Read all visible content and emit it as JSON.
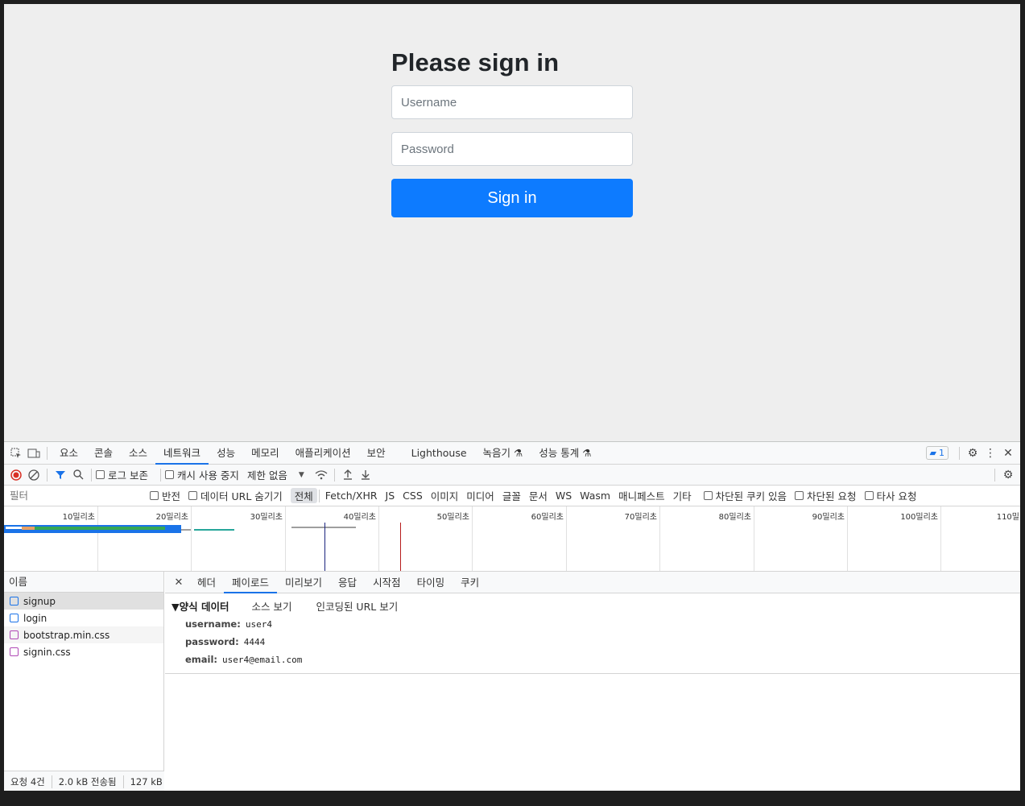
{
  "page": {
    "title": "Please sign in",
    "username_placeholder": "Username",
    "password_placeholder": "Password",
    "signin_label": "Sign in"
  },
  "devtools": {
    "main_tabs": [
      "요소",
      "콘솔",
      "소스",
      "네트워크",
      "성능",
      "메모리",
      "애플리케이션",
      "보안",
      "Lighthouse",
      "녹음기",
      "성능 통계"
    ],
    "active_tab": "네트워크",
    "issues_badge": "1",
    "toolbar": {
      "preserve_log": "로그 보존",
      "disable_cache": "캐시 사용 중지",
      "throttle": "제한 없음"
    },
    "filter": {
      "placeholder": "필터",
      "invert": "반전",
      "hide_data_urls": "데이터 URL 숨기기",
      "types": [
        "전체",
        "Fetch/XHR",
        "JS",
        "CSS",
        "이미지",
        "미디어",
        "글꼴",
        "문서",
        "WS",
        "Wasm",
        "매니페스트",
        "기타"
      ],
      "blocked_cookies": "차단된 쿠키 있음",
      "blocked_requests": "차단된 요청",
      "third_party": "타사 요청"
    },
    "timeline_ticks": [
      "10밀리초",
      "20밀리초",
      "30밀리초",
      "40밀리초",
      "50밀리초",
      "60밀리초",
      "70밀리초",
      "80밀리초",
      "90밀리초",
      "100밀리초",
      "110밀"
    ],
    "name_header": "이름",
    "requests": [
      {
        "name": "signup",
        "type": "doc"
      },
      {
        "name": "login",
        "type": "doc"
      },
      {
        "name": "bootstrap.min.css",
        "type": "css"
      },
      {
        "name": "signin.css",
        "type": "css"
      }
    ],
    "status": {
      "requests": "요청 4건",
      "transferred": "2.0 kB 전송됨",
      "resources": "127 kB"
    },
    "detail_tabs": [
      "헤더",
      "페이로드",
      "미리보기",
      "응답",
      "시작점",
      "타이밍",
      "쿠키"
    ],
    "active_detail_tab": "페이로드",
    "payload": {
      "section_title": "▼양식 데이터",
      "view_source": "소스 보기",
      "view_url_encoded": "인코딩된 URL 보기",
      "fields": [
        {
          "key": "username:",
          "value": "user4"
        },
        {
          "key": "password:",
          "value": "4444"
        },
        {
          "key": "email:",
          "value": "user4@email.com"
        }
      ]
    }
  }
}
